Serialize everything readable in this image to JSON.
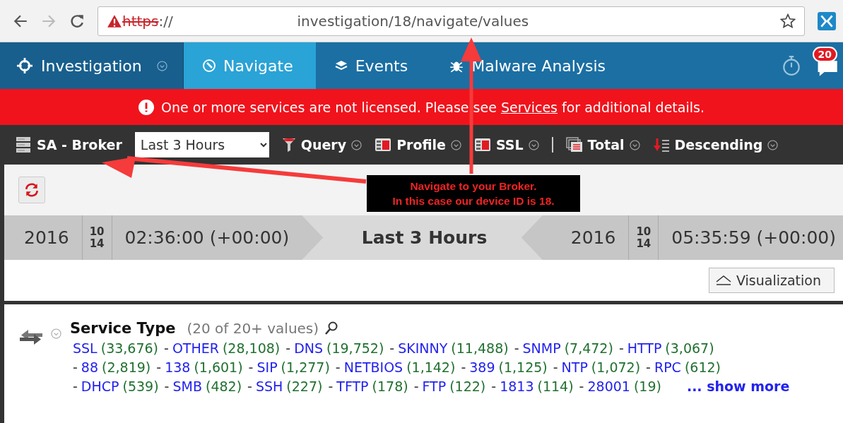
{
  "browser": {
    "back_disabled": false,
    "forward_disabled": true,
    "secure": false,
    "scheme": "https",
    "scheme_sep": "://",
    "path": "investigation/18/navigate/values"
  },
  "nav": {
    "module": "Investigation",
    "tabs": [
      {
        "label": "Navigate",
        "selected": true,
        "kind": "compass"
      },
      {
        "label": "Events",
        "selected": false,
        "kind": "layers"
      },
      {
        "label": "Malware Analysis",
        "selected": false,
        "kind": "bug"
      }
    ],
    "notifications": "20"
  },
  "alert": {
    "before": "One or more services are not licensed. Please see ",
    "link": "Services",
    "after": " for additional details."
  },
  "toolbar": {
    "device": "SA - Broker",
    "time_range": "Last 3 Hours",
    "items": [
      {
        "label": "Query",
        "kind": "funnel"
      },
      {
        "label": "Profile",
        "kind": "panel"
      },
      {
        "label": "SSL",
        "kind": "panel"
      },
      {
        "label": "Total",
        "kind": "stack"
      },
      {
        "label": "Descending",
        "kind": "sortdesc"
      }
    ]
  },
  "timeline": {
    "start": {
      "year": "2016",
      "month": "10",
      "day": "14",
      "time": "02:36:00 (+00:00)"
    },
    "label": "Last 3 Hours",
    "end": {
      "year": "2016",
      "month": "10",
      "day": "14",
      "time": "05:35:59 (+00:00)"
    }
  },
  "visualization_button": "Visualization",
  "values": {
    "title": "Service Type",
    "summary": "(20 of 20+ values)",
    "lines": [
      [
        {
          "name": "SSL",
          "count": "(33,676)"
        },
        {
          "prefix": "-",
          "name": "OTHER",
          "count": "(28,108)"
        },
        {
          "prefix": "-",
          "name": "DNS",
          "count": "(19,752)"
        },
        {
          "prefix": "-",
          "name": "SKINNY",
          "count": "(11,488)"
        },
        {
          "prefix": "-",
          "name": "SNMP",
          "count": "(7,472)"
        },
        {
          "prefix": "-",
          "name": "HTTP",
          "count": "(3,067)"
        }
      ],
      [
        {
          "prefix": "-",
          "name": "88",
          "count": "(2,819)"
        },
        {
          "prefix": "-",
          "name": "138",
          "count": "(1,601)"
        },
        {
          "prefix": "-",
          "name": "SIP",
          "count": "(1,277)"
        },
        {
          "prefix": "-",
          "name": "NETBIOS",
          "count": "(1,142)"
        },
        {
          "prefix": "-",
          "name": "389",
          "count": "(1,125)"
        },
        {
          "prefix": "-",
          "name": "NTP",
          "count": "(1,072)"
        },
        {
          "prefix": "-",
          "name": "RPC",
          "count": "(612)"
        }
      ],
      [
        {
          "prefix": "-",
          "name": "DHCP",
          "count": "(539)"
        },
        {
          "prefix": "-",
          "name": "SMB",
          "count": "(482)"
        },
        {
          "prefix": "-",
          "name": "SSH",
          "count": "(227)"
        },
        {
          "prefix": "-",
          "name": "TFTP",
          "count": "(178)"
        },
        {
          "prefix": "-",
          "name": "FTP",
          "count": "(122)"
        },
        {
          "prefix": "-",
          "name": "1813",
          "count": "(114)"
        },
        {
          "prefix": "-",
          "name": "28001",
          "count": "(19)"
        }
      ]
    ],
    "show_more": "... show more"
  },
  "callout": {
    "lines": [
      "Navigate to your Broker.",
      "In this case our device ID is 18."
    ]
  }
}
